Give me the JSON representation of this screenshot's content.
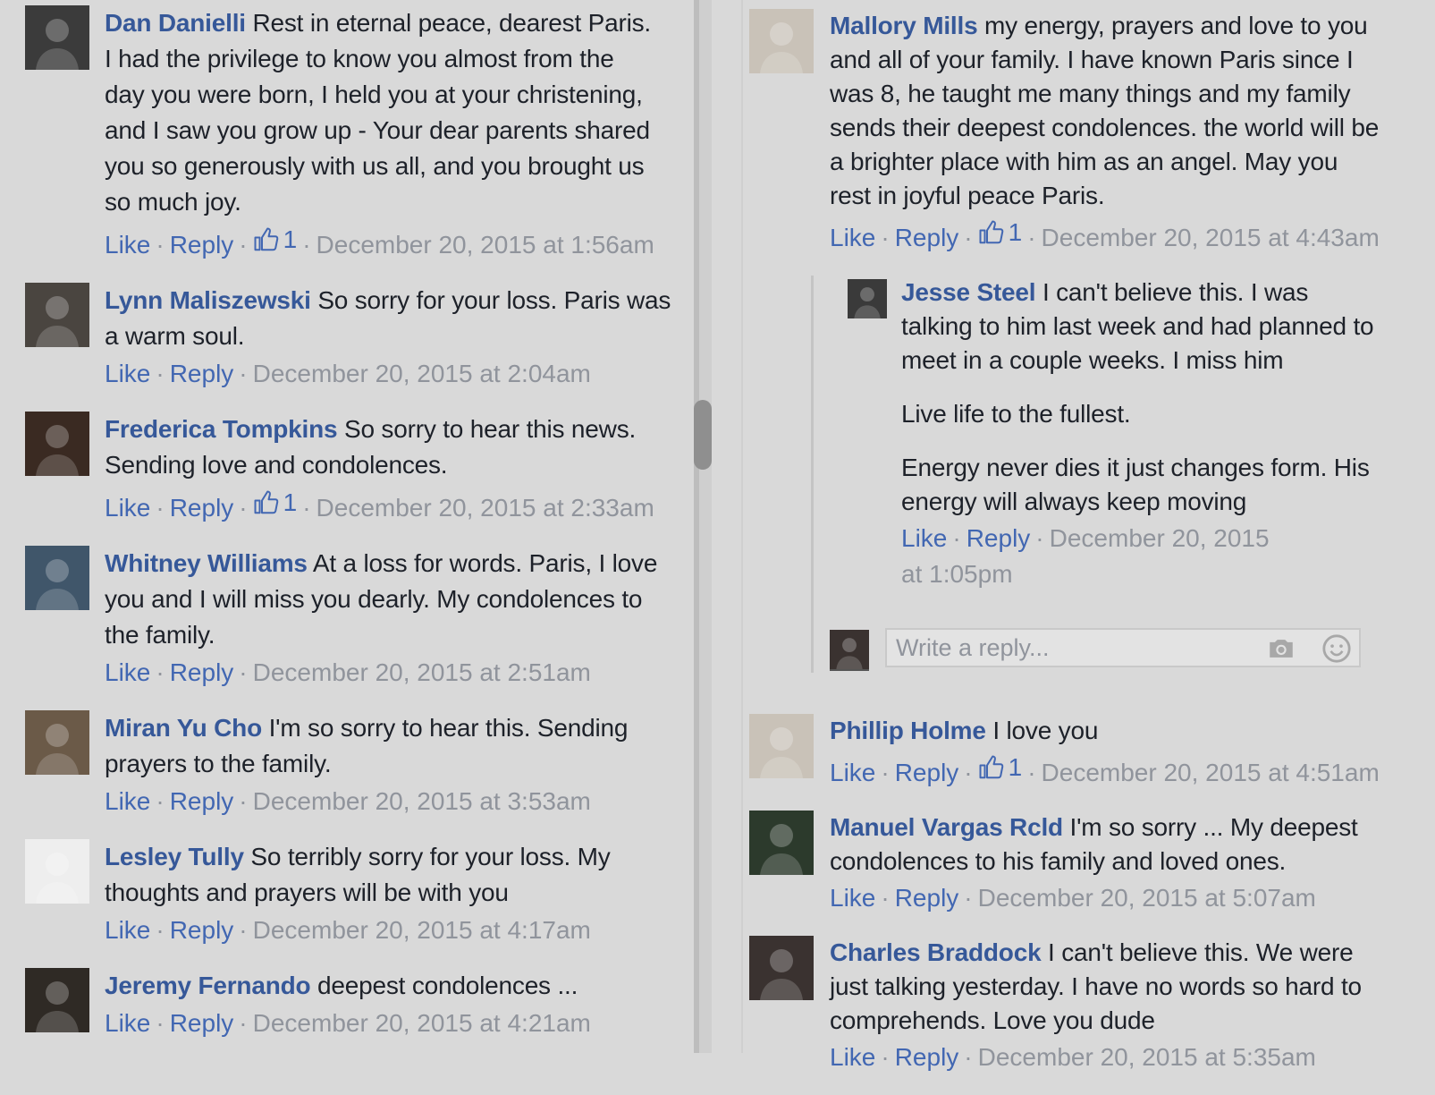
{
  "actions": {
    "like": "Like",
    "reply": "Reply",
    "sep": "·"
  },
  "left_comments": [
    {
      "name": "Dan Danielli",
      "text": "Rest in eternal peace, dearest Paris. I had the privilege to know you almost from the day you were born, I held you at your christening, and I saw you grow up - Your dear parents shared you so generously with us all, and you brought us so much joy.",
      "likes": "1",
      "time": "December 20, 2015 at 1:56am"
    },
    {
      "name": "Lynn Maliszewski",
      "text": "So sorry for your loss. Paris was a warm soul.",
      "likes": "",
      "time": "December 20, 2015 at 2:04am"
    },
    {
      "name": "Frederica Tompkins",
      "text": "So sorry to hear this news. Sending love and condolences.",
      "likes": "1",
      "time": "December 20, 2015 at 2:33am"
    },
    {
      "name": "Whitney Williams",
      "text": "At a loss for words. Paris, I love you and I will miss you dearly. My condolences to the family.",
      "likes": "",
      "time": "December 20, 2015 at 2:51am"
    },
    {
      "name": "Miran Yu Cho",
      "text": "I'm so sorry to hear this. Sending prayers to the family.",
      "likes": "",
      "time": "December 20, 2015 at 3:53am"
    },
    {
      "name": "Lesley Tully",
      "text": "So terribly sorry for your loss. My thoughts and prayers will be with you",
      "likes": "",
      "time": "December 20, 2015 at 4:17am"
    },
    {
      "name": "Jeremy Fernando",
      "text": "deepest condolences ...",
      "likes": "",
      "time": "December 20, 2015 at 4:21am"
    }
  ],
  "right_top": {
    "name": "Mallory Mills",
    "text": "my energy, prayers and love to you and all of your family. I have known Paris since I was 8, he taught me many things and my family sends their deepest condolences. the world will be a brighter place with him as an angel. May you rest in joyful peace Paris.",
    "likes": "1",
    "time": "December 20, 2015 at 4:43am"
  },
  "reply": {
    "name": "Jesse Steel",
    "text": "I can't believe this. I was talking to him last week and had planned to meet in a couple weeks. I miss him",
    "para2": "Live life to the fullest.",
    "para3": "Energy never dies it just changes form. His energy will always keep moving",
    "time": "December 20, 2015 at 1:05pm"
  },
  "reply_box": {
    "placeholder": "Write a reply..."
  },
  "right_comments": [
    {
      "name": "Phillip Holme",
      "text": "I love you",
      "likes": "1",
      "time": "December 20, 2015 at 4:51am"
    },
    {
      "name": "Manuel Vargas Rcld",
      "text": "I'm so sorry ... My deepest condolences to his family and loved ones.",
      "likes": "",
      "time": "December 20, 2015 at 5:07am"
    },
    {
      "name": "Charles Braddock",
      "text": "I can't believe this. We were just talking yesterday. I have no words so hard to comprehends. Love you dude",
      "likes": "",
      "time": "December 20, 2015 at 5:35am"
    }
  ],
  "icons": {
    "thumb": "thumbs-up-icon",
    "camera": "camera-icon",
    "emoji": "smiley-icon"
  },
  "colors": {
    "name": "#365899",
    "link": "#4267b2",
    "meta": "#90949c",
    "background": "#d9d9d9"
  }
}
